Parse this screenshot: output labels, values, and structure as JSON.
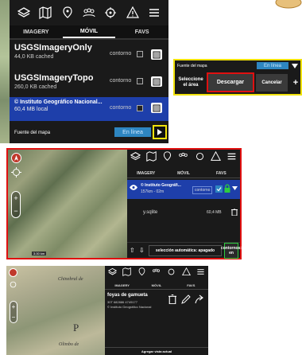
{
  "panel1": {
    "tabs": [
      "IMAGERY",
      "MÓVIL",
      "FAVS"
    ],
    "layers": [
      {
        "title": "USGSImageryOnly",
        "subtitle": "44,0 KB cached",
        "toggle_label": "contorno"
      },
      {
        "title": "USGSImageryTopo",
        "subtitle": "260,0 KB cached",
        "toggle_label": "contorno"
      },
      {
        "title": "© Instituto Geográfico Nacional...",
        "subtitle": "60,4 MB local",
        "toggle_label": "contorno"
      }
    ],
    "source_label": "Fuente del mapa",
    "source_value": "En línea"
  },
  "dialog": {
    "source_label": "Fuente del mapa",
    "source_value": "En línea",
    "select_label": "Seleccione el área",
    "download_label": "Descargar",
    "cancel_label": "Cancelar"
  },
  "panel2": {
    "tabs": [
      "IMAGERY",
      "MÓVIL",
      "FAVS"
    ],
    "layer": {
      "title": "© Instituto Geográfi...",
      "subtitle": "157km - 02m",
      "toggle_label": "contorno"
    },
    "file_name": "y.sqlite",
    "file_size": "60,4 MB",
    "auto_select": "selección automática: apagado",
    "contours_label": "contornos: en",
    "scale": "3.00 km"
  },
  "panel3": {
    "tabs": [
      "IMAGERY",
      "MÓVIL",
      "FAVS"
    ],
    "place_title": "foyas de gamueta",
    "place_coords": "30T 682886 4749177",
    "place_source": "© Instituto Geográfico Nacional",
    "map_labels": [
      "Chinebral de",
      "P",
      "Olimbo de"
    ],
    "add_view": "Agregar vista actual"
  },
  "colors": {
    "highlight_yellow": "#f1e20a",
    "highlight_red": "#e01010",
    "accent_blue": "#2e86c1",
    "selected_row": "#1e3faa"
  }
}
